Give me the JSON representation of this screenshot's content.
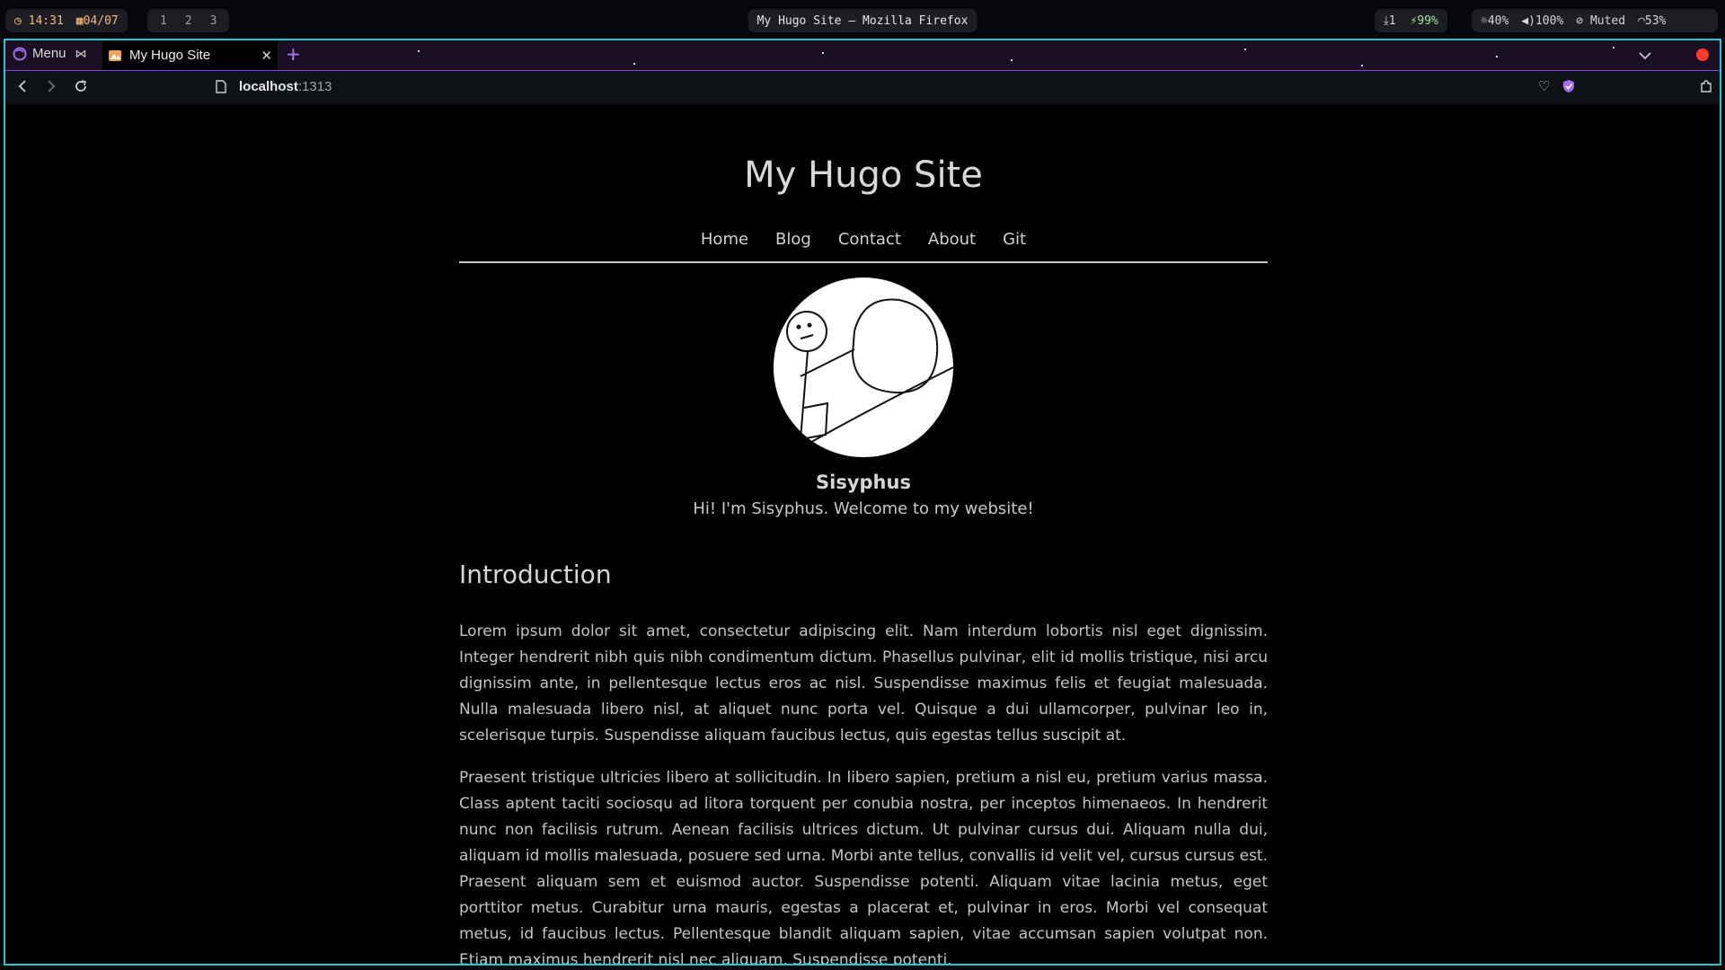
{
  "statusbar": {
    "time": "14:31",
    "date": "04/07",
    "workspaces": [
      "1",
      "2",
      "3"
    ],
    "window_title": "My Hugo Site — Mozilla Firefox",
    "downloads": "1",
    "battery": "99%",
    "brightness": "40%",
    "volume": "100%",
    "mic": "Muted",
    "wifi": "53%"
  },
  "browser": {
    "menu_label": "Menu",
    "tab_title": "My Hugo Site",
    "url_host": "localhost",
    "url_port": ":1313",
    "accent_color": "#23c7cf"
  },
  "site": {
    "title": "My Hugo Site",
    "nav": [
      "Home",
      "Blog",
      "Contact",
      "About",
      "Git"
    ],
    "author_name": "Sisyphus",
    "bio": "Hi! I'm Sisyphus. Welcome to my website!",
    "heading": "Introduction",
    "paragraphs": [
      "Lorem ipsum dolor sit amet, consectetur adipiscing elit. Nam interdum lobortis nisl eget dignissim. Integer hendrerit nibh quis nibh condimentum dictum. Phasellus pulvinar, elit id mollis tristique, nisi arcu dignissim ante, in pellentesque lectus eros ac nisl. Suspendisse maximus felis et feugiat malesuada. Nulla malesuada libero nisl, at aliquet nunc porta vel. Quisque a dui ullamcorper, pulvinar leo in, scelerisque turpis. Suspendisse aliquam faucibus lectus, quis egestas tellus suscipit at.",
      "Praesent tristique ultricies libero at sollicitudin. In libero sapien, pretium a nisl eu, pretium varius massa. Class aptent taciti sociosqu ad litora torquent per conubia nostra, per inceptos himenaeos. In hendrerit nunc non facilisis rutrum. Aenean facilisis ultrices dictum. Ut pulvinar cursus dui. Aliquam nulla dui, aliquam id mollis malesuada, posuere sed urna. Morbi ante tellus, convallis id velit vel, cursus cursus est. Praesent aliquam sem et euismod auctor. Suspendisse potenti. Aliquam vitae lacinia metus, eget porttitor metus. Curabitur urna mauris, egestas a placerat et, pulvinar in eros. Morbi vel consequat metus, id faucibus lectus. Pellentesque blandit aliquam sapien, vitae accumsan sapien volutpat non. Etiam maximus hendrerit nisl nec aliquam. Suspendisse potenti."
    ]
  }
}
